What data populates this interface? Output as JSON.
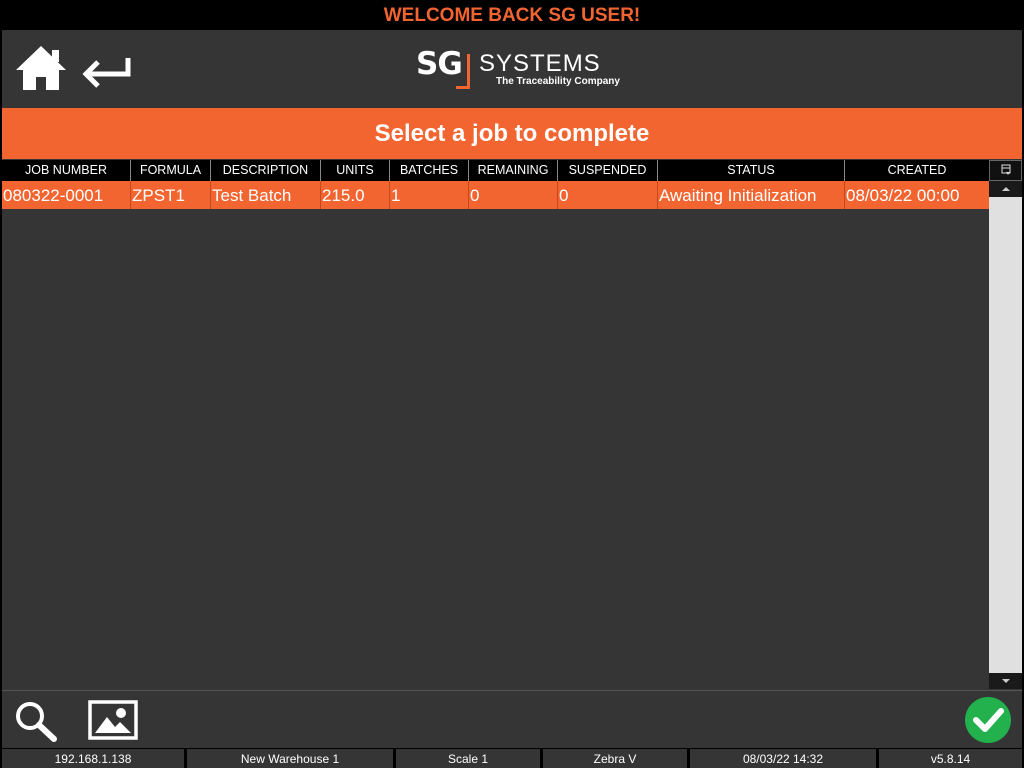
{
  "header": {
    "welcome": "WELCOME BACK SG USER!",
    "logo": {
      "mark": "SG",
      "name": "SYSTEMS",
      "tagline": "The Traceability Company"
    }
  },
  "nav": {
    "home_icon": "home-icon",
    "back_icon": "return-arrow-icon"
  },
  "page_title": "Select a job to complete",
  "table": {
    "columns": [
      "JOB NUMBER",
      "FORMULA",
      "DESCRIPTION",
      "UNITS",
      "BATCHES",
      "REMAINING",
      "SUSPENDED",
      "STATUS",
      "CREATED"
    ],
    "rows": [
      [
        "080322-0001",
        "ZPST1",
        "Test Batch",
        "215.0",
        "1",
        "0",
        "0",
        "Awaiting Initialization",
        "08/03/22 00:00"
      ]
    ],
    "selected_row": 0
  },
  "actions": {
    "search_icon": "magnifier-icon",
    "image_icon": "picture-icon",
    "confirm_icon": "checkmark-icon"
  },
  "status": {
    "ip": "192.168.1.138",
    "warehouse": "New Warehouse 1",
    "scale": "Scale 1",
    "printer": "Zebra V",
    "datetime": "08/03/22 14:32",
    "version": "v5.8.14"
  },
  "colors": {
    "accent": "#f26531",
    "background": "#353535",
    "confirm": "#22b14c"
  }
}
